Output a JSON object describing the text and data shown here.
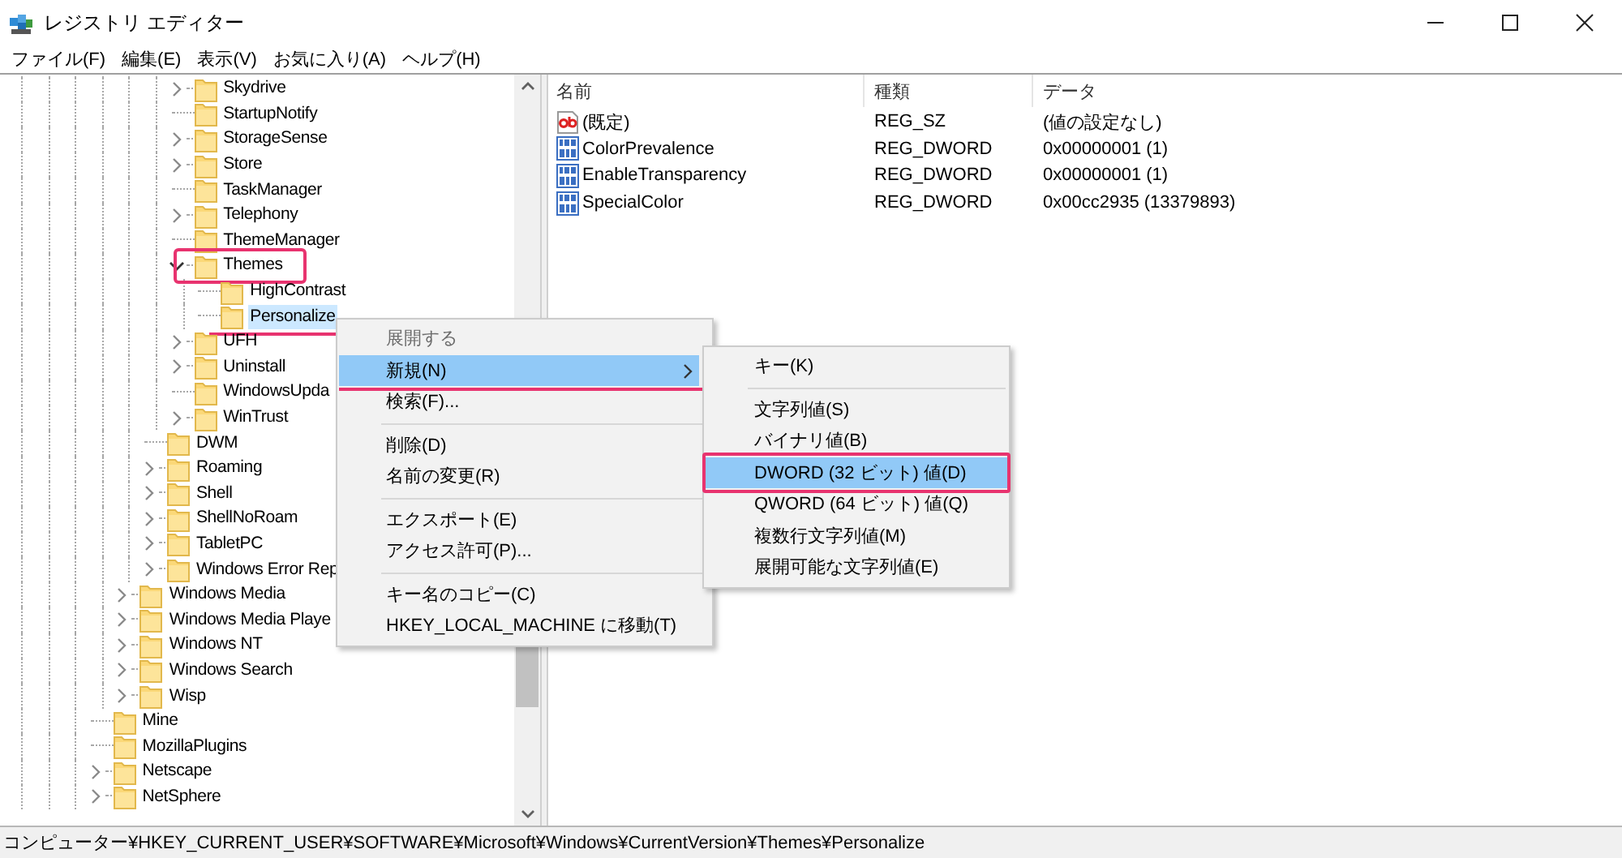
{
  "window": {
    "title": "レジストリ エディター"
  },
  "menu_bar": [
    "ファイル(F)",
    "編集(E)",
    "表示(V)",
    "お気に入り(A)",
    "ヘルプ(H)"
  ],
  "tree": {
    "items": [
      {
        "children": [
          {
            "children": [
              {
                "children": [
                  {
                    "label": "Skydrive",
                    "expandable": true,
                    "expanded": false,
                    "selected": false
                  },
                  {
                    "label": "StartupNotify",
                    "expandable": false,
                    "selected": false
                  },
                  {
                    "label": "StorageSense",
                    "expandable": true,
                    "expanded": false,
                    "selected": false
                  },
                  {
                    "label": "Store",
                    "expandable": true,
                    "expanded": false,
                    "selected": false
                  },
                  {
                    "label": "TaskManager",
                    "expandable": false,
                    "selected": false
                  },
                  {
                    "label": "Telephony",
                    "expandable": true,
                    "expanded": false,
                    "selected": false
                  },
                  {
                    "label": "ThemeManager",
                    "expandable": false,
                    "selected": false
                  },
                  {
                    "label": "Themes",
                    "expandable": true,
                    "expanded": true,
                    "selected": false,
                    "framed": true,
                    "children": [
                      {
                        "label": "HighContrast",
                        "expandable": false,
                        "selected": false
                      },
                      {
                        "label": "Personalize",
                        "expandable": false,
                        "selected": true,
                        "underlined": true
                      }
                    ]
                  },
                  {
                    "label": "UFH",
                    "expandable": true,
                    "expanded": false,
                    "selected": false
                  },
                  {
                    "label": "Uninstall",
                    "expandable": true,
                    "expanded": false,
                    "selected": false
                  },
                  {
                    "label": "WindowsUpda",
                    "expandable": false,
                    "selected": false
                  },
                  {
                    "label": "WinTrust",
                    "expandable": true,
                    "expanded": false,
                    "selected": false
                  }
                ]
              },
              {
                "label": "DWM",
                "expandable": false,
                "selected": false
              },
              {
                "label": "Roaming",
                "expandable": true,
                "expanded": false,
                "selected": false
              },
              {
                "label": "Shell",
                "expandable": true,
                "expanded": false,
                "selected": false
              },
              {
                "label": "ShellNoRoam",
                "expandable": true,
                "expanded": false,
                "selected": false
              },
              {
                "label": "TabletPC",
                "expandable": true,
                "expanded": false,
                "selected": false
              },
              {
                "label": "Windows Error Rep",
                "expandable": true,
                "expanded": false,
                "selected": false
              }
            ]
          },
          {
            "label": "Windows Media",
            "expandable": true,
            "expanded": false,
            "selected": false
          },
          {
            "label": "Windows Media Playe",
            "expandable": true,
            "expanded": false,
            "selected": false
          },
          {
            "label": "Windows NT",
            "expandable": true,
            "expanded": false,
            "selected": false
          },
          {
            "label": "Windows Search",
            "expandable": true,
            "expanded": false,
            "selected": false
          },
          {
            "label": "Wisp",
            "expandable": true,
            "expanded": false,
            "selected": false
          }
        ]
      },
      {
        "label": "Mine",
        "expandable": false,
        "selected": false
      },
      {
        "label": "MozillaPlugins",
        "expandable": false,
        "selected": false
      },
      {
        "label": "Netscape",
        "expandable": true,
        "expanded": false,
        "selected": false
      },
      {
        "label": "NetSphere",
        "expandable": true,
        "expanded": false,
        "selected": false
      }
    ]
  },
  "values": {
    "columns": [
      "名前",
      "種類",
      "データ"
    ],
    "rows": [
      {
        "kind": "string",
        "name": "(既定)",
        "type": "REG_SZ",
        "data": "(値の設定なし)"
      },
      {
        "kind": "binary",
        "name": "ColorPrevalence",
        "type": "REG_DWORD",
        "data": "0x00000001 (1)"
      },
      {
        "kind": "binary",
        "name": "EnableTransparency",
        "type": "REG_DWORD",
        "data": "0x00000001 (1)"
      },
      {
        "kind": "binary",
        "name": "SpecialColor",
        "type": "REG_DWORD",
        "data": "0x00cc2935 (13379893)"
      }
    ]
  },
  "context_menu": {
    "items": [
      {
        "kind": "item",
        "label": "展開する",
        "disabled": true,
        "selected": false
      },
      {
        "kind": "item",
        "label": "新規(N)",
        "disabled": false,
        "selected": true,
        "submenu": true,
        "underlined": true
      },
      {
        "kind": "item",
        "label": "検索(F)...",
        "disabled": false,
        "selected": false
      },
      {
        "kind": "separator"
      },
      {
        "kind": "item",
        "label": "削除(D)",
        "disabled": false,
        "selected": false
      },
      {
        "kind": "item",
        "label": "名前の変更(R)",
        "disabled": false,
        "selected": false
      },
      {
        "kind": "separator"
      },
      {
        "kind": "item",
        "label": "エクスポート(E)",
        "disabled": false,
        "selected": false
      },
      {
        "kind": "item",
        "label": "アクセス許可(P)...",
        "disabled": false,
        "selected": false
      },
      {
        "kind": "separator"
      },
      {
        "kind": "item",
        "label": "キー名のコピー(C)",
        "disabled": false,
        "selected": false
      },
      {
        "kind": "item",
        "label": "HKEY_LOCAL_MACHINE に移動(T)",
        "disabled": false,
        "selected": false
      }
    ]
  },
  "submenu": {
    "items": [
      {
        "kind": "item",
        "label": "キー(K)",
        "selected": false
      },
      {
        "kind": "separator"
      },
      {
        "kind": "item",
        "label": "文字列値(S)",
        "selected": false
      },
      {
        "kind": "item",
        "label": "バイナリ値(B)",
        "selected": false
      },
      {
        "kind": "item",
        "label": "DWORD (32 ビット) 値(D)",
        "selected": true,
        "framed": true
      },
      {
        "kind": "item",
        "label": "QWORD (64 ビット) 値(Q)",
        "selected": false
      },
      {
        "kind": "item",
        "label": "複数行文字列値(M)",
        "selected": false
      },
      {
        "kind": "item",
        "label": "展開可能な文字列値(E)",
        "selected": false
      }
    ]
  },
  "status_bar": "コンピューター¥HKEY_CURRENT_USER¥SOFTWARE¥Microsoft¥Windows¥CurrentVersion¥Themes¥Personalize"
}
